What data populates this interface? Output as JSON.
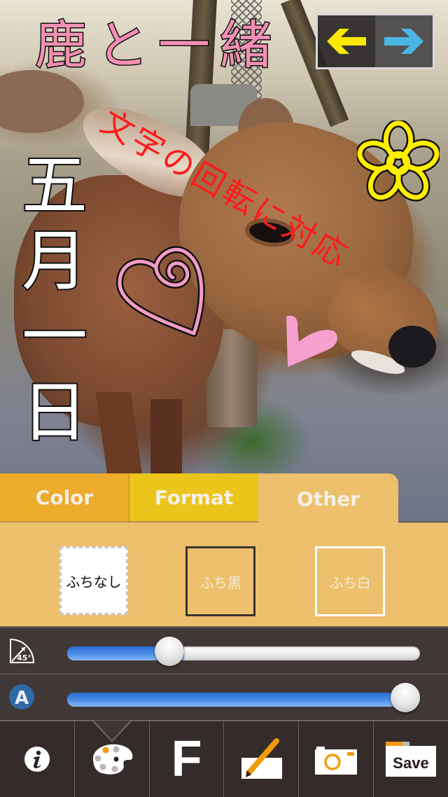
{
  "canvas": {
    "stickers": {
      "title": "鹿と一緒",
      "rotated_text": "文字の回転に対応",
      "vertical_text": [
        "五",
        "月",
        "一",
        "日"
      ],
      "flower": "flower-sticker",
      "heart_swirl": "heart-swirl-sticker",
      "heart_solid": "heart-solid-sticker"
    },
    "colors": {
      "title_pink": "#f48fb4",
      "rotated_red": "#ff1a1a",
      "flower_yellow": "#ffee00",
      "heart_pink": "#f29cc4"
    }
  },
  "nav": {
    "back_icon": "arrow-left-icon",
    "forward_icon": "arrow-right-icon",
    "back_color": "#ffe800",
    "forward_color": "#4ab6e4"
  },
  "tabs": [
    {
      "label": "Color",
      "active": false
    },
    {
      "label": "Format",
      "active": false
    },
    {
      "label": "Other",
      "active": true
    }
  ],
  "frame_options": [
    {
      "label": "ふちなし",
      "selected": true
    },
    {
      "label": "ふち黒",
      "selected": false
    },
    {
      "label": "ふち白",
      "selected": false
    }
  ],
  "sliders": {
    "rotation": {
      "icon": "rotation-45-icon",
      "icon_label": "45°",
      "value_percent": 27
    },
    "alpha": {
      "icon": "alpha-a-icon",
      "icon_label": "A",
      "value_percent": 100
    }
  },
  "toolbar": [
    {
      "id": "info",
      "icon": "info-icon"
    },
    {
      "id": "palette",
      "icon": "palette-icon",
      "active": true
    },
    {
      "id": "font",
      "icon": "font-icon",
      "label": "F"
    },
    {
      "id": "draw",
      "icon": "pen-icon"
    },
    {
      "id": "camera",
      "icon": "camera-icon"
    },
    {
      "id": "save",
      "icon": "save-icon",
      "label": "Save"
    }
  ],
  "accent": {
    "orange": "#f29a0a",
    "blue": "#3d84e0"
  }
}
